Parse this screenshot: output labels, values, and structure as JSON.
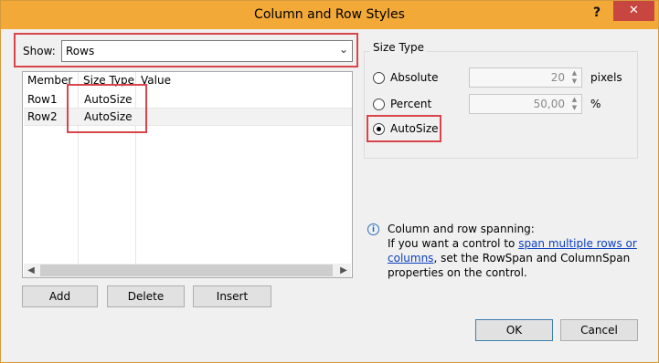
{
  "window": {
    "title": "Column and Row Styles",
    "help": "?",
    "close": "✕"
  },
  "show": {
    "label": "Show:",
    "value": "Rows"
  },
  "grid": {
    "headers": [
      "Member",
      "Size Type",
      "Value"
    ],
    "rows": [
      {
        "member": "Row1",
        "size_type": "AutoSize",
        "value": ""
      },
      {
        "member": "Row2",
        "size_type": "AutoSize",
        "value": ""
      }
    ]
  },
  "buttons": {
    "add": "Add",
    "delete": "Delete",
    "insert": "Insert",
    "ok": "OK",
    "cancel": "Cancel"
  },
  "size_type": {
    "title": "Size Type",
    "absolute": {
      "label": "Absolute",
      "value": "20",
      "unit": "pixels"
    },
    "percent": {
      "label": "Percent",
      "value": "50,00",
      "unit": "%"
    },
    "autosize": {
      "label": "AutoSize"
    },
    "selected": "AutoSize"
  },
  "info": {
    "heading": "Column and row spanning:",
    "text_before": "If you want a control to ",
    "link": "span multiple rows or columns",
    "text_after": ", set the RowSpan and ColumnSpan properties on the control."
  },
  "colors": {
    "titlebar": "#f3a937",
    "close": "#c7463f",
    "highlight": "#d8454a"
  }
}
